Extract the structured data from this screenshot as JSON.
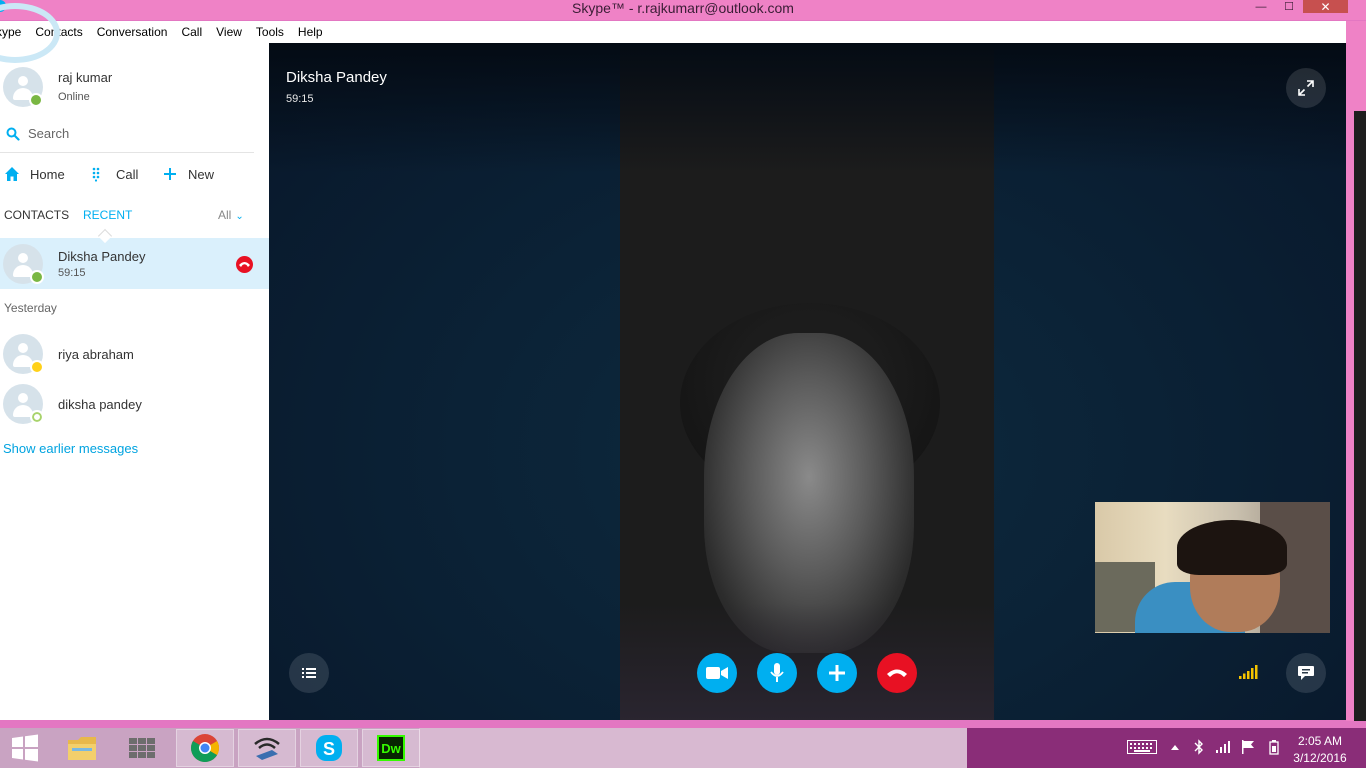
{
  "window": {
    "title": "Skype™ - r.rajkumarr@outlook.com",
    "min_glyph": "—",
    "max_glyph": "☐",
    "close_glyph": "✕"
  },
  "menu": [
    "kype",
    "Contacts",
    "Conversation",
    "Call",
    "View",
    "Tools",
    "Help"
  ],
  "profile": {
    "name": "raj kumar",
    "status": "Online"
  },
  "search": {
    "placeholder": "Search"
  },
  "nav": {
    "home": "Home",
    "call": "Call",
    "new": "New"
  },
  "tabs": {
    "contacts": "CONTACTS",
    "recent": "RECENT",
    "filter": "All",
    "filter_chevron": "⌄"
  },
  "recent": {
    "active": {
      "name": "Diksha Pandey",
      "sub": "59:15",
      "presence": "online"
    },
    "section_label": "Yesterday",
    "items": [
      {
        "name": "riya abraham",
        "presence": "away"
      },
      {
        "name": "diksha pandey",
        "presence": "offline"
      }
    ],
    "show_earlier": "Show earlier messages"
  },
  "call": {
    "caller_name": "Diksha Pandey",
    "duration": "59:15",
    "controls": [
      "video-icon",
      "microphone-icon",
      "add-icon",
      "hangup-icon"
    ],
    "left_control": "call-list-icon",
    "right_control": "chat-icon",
    "signal": "signal-strength-icon"
  },
  "taskbar": {
    "apps": [
      "file-explorer",
      "store-app",
      "chrome",
      "connectify",
      "skype",
      "dreamweaver"
    ],
    "dreamweaver_label": "Dw",
    "time": "2:05 AM",
    "date": "3/12/2016"
  },
  "colors": {
    "skype_blue": "#00aff0",
    "hangup_red": "#e81123",
    "online_green": "#7ab743",
    "away_yellow": "#ffd11a",
    "titlebar_pink": "#ef82c6"
  }
}
